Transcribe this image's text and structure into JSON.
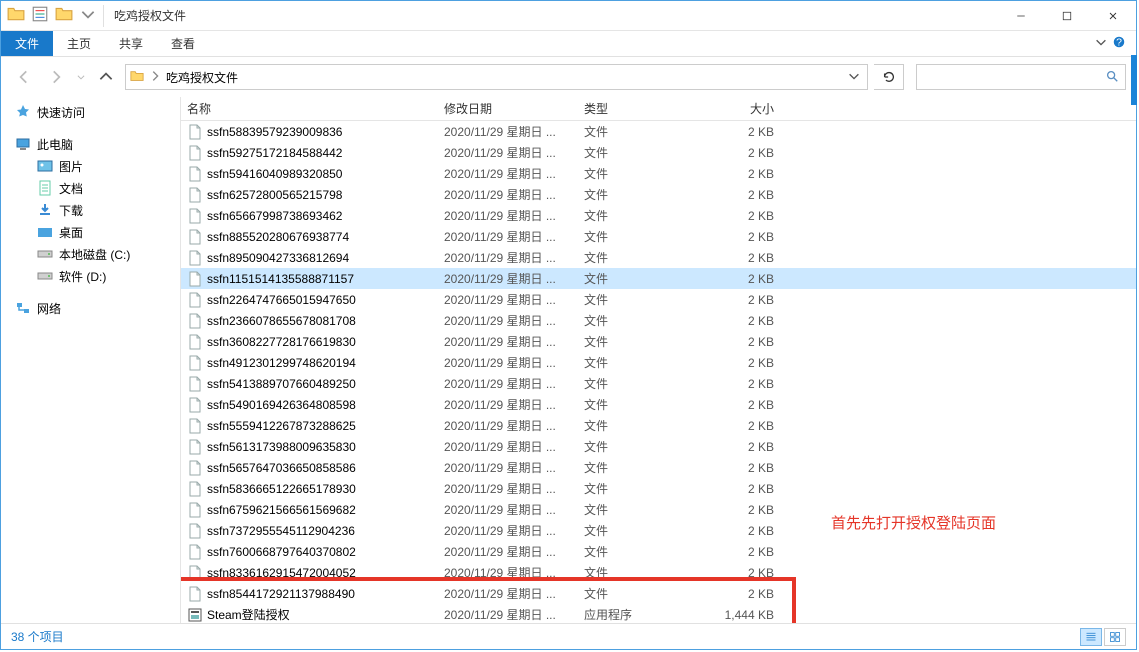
{
  "window": {
    "title": "吃鸡授权文件"
  },
  "ribbon": {
    "file": "文件",
    "tabs": [
      "主页",
      "共享",
      "查看"
    ]
  },
  "address": {
    "crumbs": [
      "吃鸡授权文件"
    ]
  },
  "nav": {
    "quick": "快速访问",
    "pc": "此电脑",
    "pc_children": [
      {
        "icon": "pic",
        "label": "图片"
      },
      {
        "icon": "doc",
        "label": "文档"
      },
      {
        "icon": "dl",
        "label": "下载"
      },
      {
        "icon": "desk",
        "label": "桌面"
      },
      {
        "icon": "disk",
        "label": "本地磁盘 (C:)"
      },
      {
        "icon": "disk",
        "label": "软件 (D:)"
      }
    ],
    "net": "网络"
  },
  "columns": {
    "name": "名称",
    "date": "修改日期",
    "type": "类型",
    "size": "大小"
  },
  "rows": [
    {
      "name": "ssfn58839579239009836",
      "date": "2020/11/29 星期日 ...",
      "type": "文件",
      "size": "2 KB",
      "sel": false,
      "icon": "file"
    },
    {
      "name": "ssfn59275172184588442",
      "date": "2020/11/29 星期日 ...",
      "type": "文件",
      "size": "2 KB",
      "sel": false,
      "icon": "file"
    },
    {
      "name": "ssfn59416040989320850",
      "date": "2020/11/29 星期日 ...",
      "type": "文件",
      "size": "2 KB",
      "sel": false,
      "icon": "file"
    },
    {
      "name": "ssfn62572800565215798",
      "date": "2020/11/29 星期日 ...",
      "type": "文件",
      "size": "2 KB",
      "sel": false,
      "icon": "file"
    },
    {
      "name": "ssfn65667998738693462",
      "date": "2020/11/29 星期日 ...",
      "type": "文件",
      "size": "2 KB",
      "sel": false,
      "icon": "file"
    },
    {
      "name": "ssfn88552028067693877​4",
      "date": "2020/11/29 星期日 ...",
      "type": "文件",
      "size": "2 KB",
      "sel": false,
      "icon": "file"
    },
    {
      "name": "ssfn895090427336812694",
      "date": "2020/11/29 星期日 ...",
      "type": "文件",
      "size": "2 KB",
      "sel": false,
      "icon": "file"
    },
    {
      "name": "ssfn1151514135588871157",
      "date": "2020/11/29 星期日 ...",
      "type": "文件",
      "size": "2 KB",
      "sel": true,
      "icon": "file"
    },
    {
      "name": "ssfn2264747665015947650",
      "date": "2020/11/29 星期日 ...",
      "type": "文件",
      "size": "2 KB",
      "sel": false,
      "icon": "file"
    },
    {
      "name": "ssfn2366078655678081708",
      "date": "2020/11/29 星期日 ...",
      "type": "文件",
      "size": "2 KB",
      "sel": false,
      "icon": "file"
    },
    {
      "name": "ssfn3608227728176619830",
      "date": "2020/11/29 星期日 ...",
      "type": "文件",
      "size": "2 KB",
      "sel": false,
      "icon": "file"
    },
    {
      "name": "ssfn4912301299748620194",
      "date": "2020/11/29 星期日 ...",
      "type": "文件",
      "size": "2 KB",
      "sel": false,
      "icon": "file"
    },
    {
      "name": "ssfn5413889707660489250",
      "date": "2020/11/29 星期日 ...",
      "type": "文件",
      "size": "2 KB",
      "sel": false,
      "icon": "file"
    },
    {
      "name": "ssfn5490169426364808598",
      "date": "2020/11/29 星期日 ...",
      "type": "文件",
      "size": "2 KB",
      "sel": false,
      "icon": "file"
    },
    {
      "name": "ssfn5559412267873288625",
      "date": "2020/11/29 星期日 ...",
      "type": "文件",
      "size": "2 KB",
      "sel": false,
      "icon": "file"
    },
    {
      "name": "ssfn5613173988009635830",
      "date": "2020/11/29 星期日 ...",
      "type": "文件",
      "size": "2 KB",
      "sel": false,
      "icon": "file"
    },
    {
      "name": "ssfn5657647036650858586",
      "date": "2020/11/29 星期日 ...",
      "type": "文件",
      "size": "2 KB",
      "sel": false,
      "icon": "file"
    },
    {
      "name": "ssfn5836665122665178930",
      "date": "2020/11/29 星期日 ...",
      "type": "文件",
      "size": "2 KB",
      "sel": false,
      "icon": "file"
    },
    {
      "name": "ssfn6759621566561569682",
      "date": "2020/11/29 星期日 ...",
      "type": "文件",
      "size": "2 KB",
      "sel": false,
      "icon": "file"
    },
    {
      "name": "ssfn7372955545112904236",
      "date": "2020/11/29 星期日 ...",
      "type": "文件",
      "size": "2 KB",
      "sel": false,
      "icon": "file"
    },
    {
      "name": "ssfn7600668797640370802",
      "date": "2020/11/29 星期日 ...",
      "type": "文件",
      "size": "2 KB",
      "sel": false,
      "icon": "file"
    },
    {
      "name": "ssfn8336162915472004052",
      "date": "2020/11/29 星期日 ...",
      "type": "文件",
      "size": "2 KB",
      "sel": false,
      "icon": "file"
    },
    {
      "name": "ssfn8544172921137988490",
      "date": "2020/11/29 星期日 ...",
      "type": "文件",
      "size": "2 KB",
      "sel": false,
      "icon": "file"
    },
    {
      "name": "Steam登陆授权",
      "date": "2020/11/29 星期日 ...",
      "type": "应用程序",
      "size": "1,444 KB",
      "sel": false,
      "icon": "exe"
    }
  ],
  "status": {
    "count": "38 个项目"
  },
  "annotation": "首先先打开授权登陆页面"
}
